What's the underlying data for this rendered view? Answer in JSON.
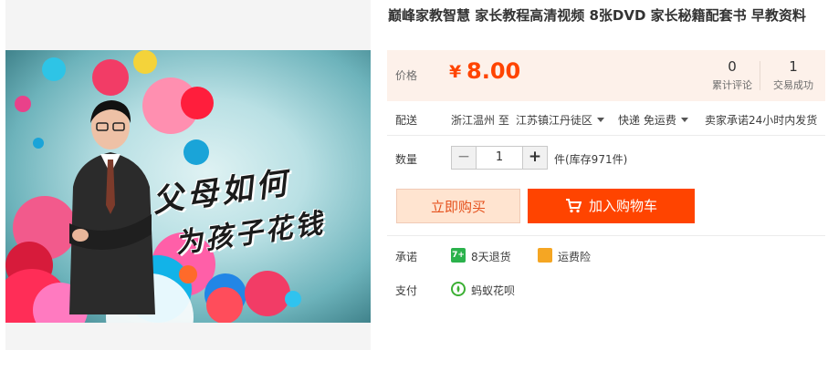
{
  "product": {
    "title": "巅峰家教智慧 家长教程高清视频 8张DVD 家长秘籍配套书 早教资料",
    "image_title_line1": "父母如何",
    "image_title_line2": "为孩子花钱"
  },
  "price": {
    "label": "价格",
    "currency": "¥",
    "value": "8.00",
    "accent_color": "#ff4400"
  },
  "stats": {
    "reviews_count": "0",
    "reviews_label": "累计评论",
    "sales_count": "1",
    "sales_label": "交易成功"
  },
  "shipping": {
    "label": "配送",
    "from": "浙江温州 至",
    "to": "江苏镇江丹徒区",
    "method": "快递 免运费",
    "promise": "卖家承诺24小时内发货"
  },
  "quantity": {
    "label": "数量",
    "minus": "−",
    "value": "1",
    "plus": "+",
    "stock": "件(库存971件)"
  },
  "actions": {
    "buy_now": "立即购买",
    "add_to_cart": "加入购物车"
  },
  "guarantee": {
    "label": "承诺",
    "returns_icon_text": "7+",
    "returns": "8天退货",
    "insurance": "运费险"
  },
  "payment": {
    "label": "支付",
    "method": "蚂蚁花呗"
  }
}
